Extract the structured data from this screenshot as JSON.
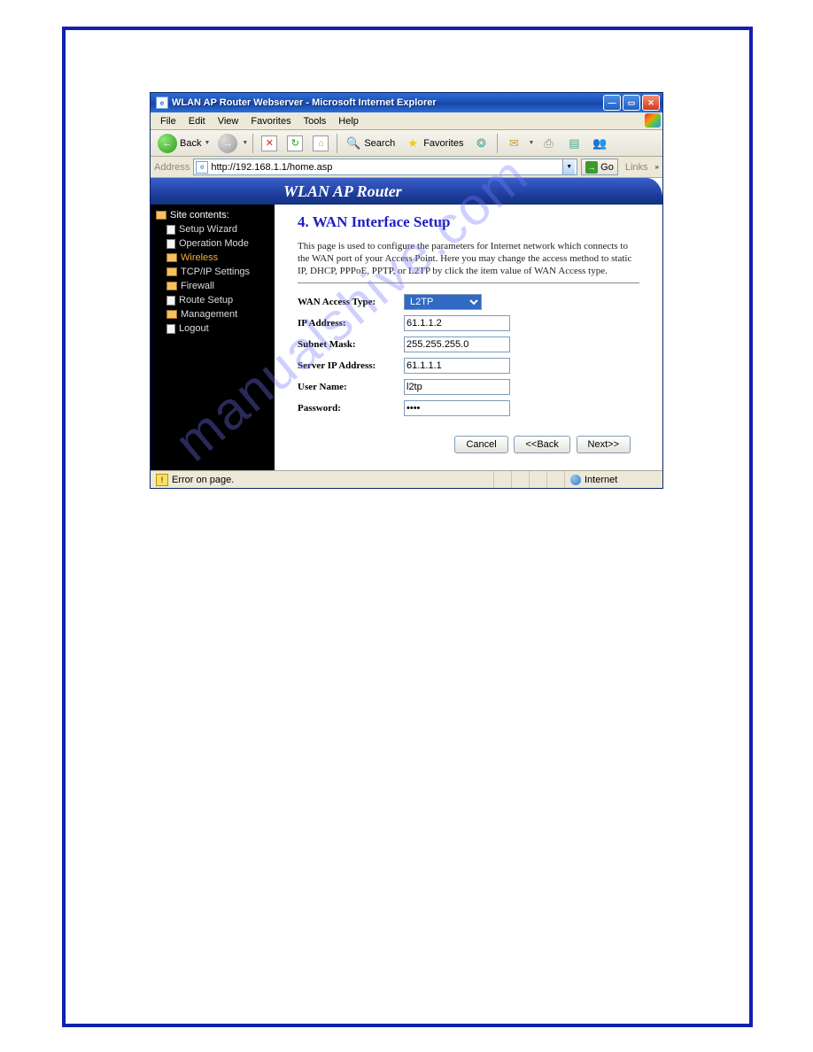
{
  "window": {
    "title": "WLAN AP Router Webserver - Microsoft Internet Explorer"
  },
  "menubar": {
    "file": "File",
    "edit": "Edit",
    "view": "View",
    "favorites": "Favorites",
    "tools": "Tools",
    "help": "Help"
  },
  "toolbar": {
    "back": "Back",
    "search": "Search",
    "favorites": "Favorites"
  },
  "addressbar": {
    "label": "Address",
    "url": "http://192.168.1.1/home.asp",
    "go": "Go",
    "links": "Links"
  },
  "banner": {
    "title": "WLAN AP Router"
  },
  "sidebar": {
    "header": "Site contents:",
    "items": [
      {
        "label": "Setup Wizard",
        "icon": "doc"
      },
      {
        "label": "Operation Mode",
        "icon": "doc"
      },
      {
        "label": "Wireless",
        "icon": "folder",
        "active": true
      },
      {
        "label": "TCP/IP Settings",
        "icon": "folder"
      },
      {
        "label": "Firewall",
        "icon": "folder"
      },
      {
        "label": "Route Setup",
        "icon": "doc"
      },
      {
        "label": "Management",
        "icon": "folder"
      },
      {
        "label": "Logout",
        "icon": "doc"
      }
    ]
  },
  "main": {
    "heading": "4. WAN Interface Setup",
    "desc": "This page is used to configure the parameters for Internet network which connects to the WAN port of your Access Point. Here you may change the access method to static IP, DHCP, PPPoE, PPTP, or L2TP by click the item value of WAN Access type.",
    "form": {
      "wan_access_type": {
        "label": "WAN Access Type:",
        "value": "L2TP"
      },
      "ip_address": {
        "label": "IP Address:",
        "value": "61.1.1.2"
      },
      "subnet_mask": {
        "label": "Subnet Mask:",
        "value": "255.255.255.0"
      },
      "server_ip": {
        "label": "Server IP Address:",
        "value": "61.1.1.1"
      },
      "user_name": {
        "label": "User Name:",
        "value": "l2tp"
      },
      "password": {
        "label": "Password:",
        "value": "••••"
      }
    },
    "buttons": {
      "cancel": "Cancel",
      "back": "<<Back",
      "next": "Next>>"
    }
  },
  "statusbar": {
    "error": "Error on page.",
    "zone": "Internet"
  },
  "watermark": "manualshive.com"
}
